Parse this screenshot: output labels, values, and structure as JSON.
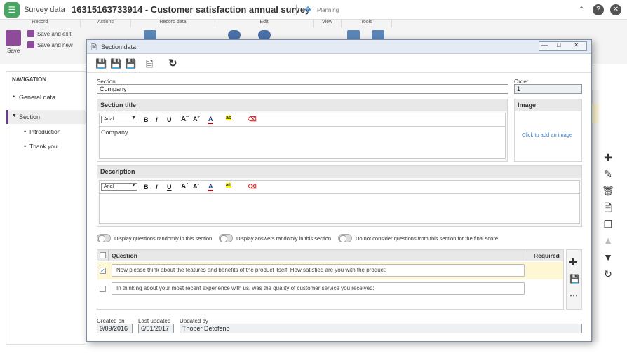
{
  "header": {
    "crumb": "Survey data",
    "title": "16315163733914 - Customer satisfaction annual survey",
    "planning": "Planning"
  },
  "ribbon": {
    "groups": [
      "Record",
      "Actions",
      "Record data",
      "Edit",
      "View",
      "Tools"
    ],
    "save": "Save",
    "save_exit": "Save and exit",
    "save_new": "Save and new"
  },
  "nav": {
    "title": "NAVIGATION",
    "items": [
      "General data",
      "Section",
      "Introduction",
      "Thank you"
    ]
  },
  "modal": {
    "title": "Section data",
    "section_label": "Section",
    "section_value": "Company",
    "order_label": "Order",
    "order_value": "1",
    "section_title_label": "Section title",
    "font": "Arial",
    "section_title_text": "Company",
    "image_label": "Image",
    "image_link": "Click to add an image",
    "description_label": "Description",
    "toggles": [
      "Display questions randomly in this section",
      "Display answers randomly in this section",
      "Do not consider questions from this section for the final score"
    ],
    "table": {
      "col_question": "Question",
      "col_required": "Required",
      "rows": [
        {
          "text": "Now please think about the features and benefits of the product itself. How satisfied are you with the product:",
          "checked": true
        },
        {
          "text": "In thinking about your most recent experience with us, was the quality of customer service you received:",
          "checked": false
        }
      ]
    },
    "footer": {
      "created_label": "Created on",
      "created": "9/09/2016",
      "updated_label": "Last updated",
      "updated": "6/01/2017",
      "by_label": "Updated by",
      "by": "Thober Detofeno"
    }
  }
}
